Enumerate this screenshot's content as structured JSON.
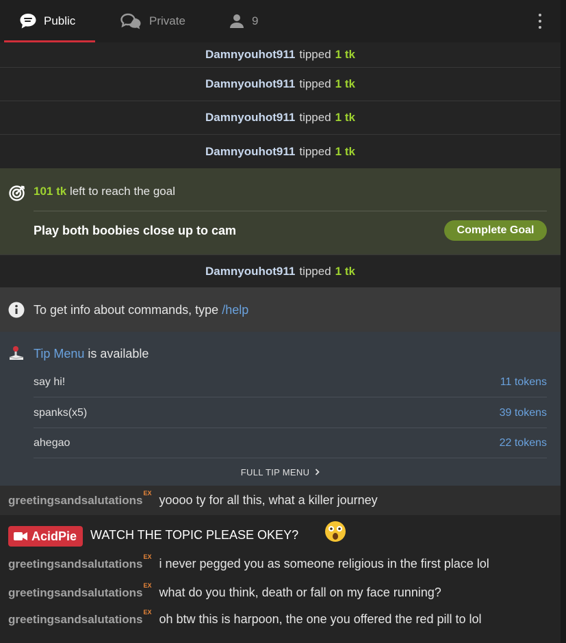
{
  "header": {
    "tabs": [
      {
        "label": "Public",
        "icon": "chat-bubble-icon",
        "active": true
      },
      {
        "label": "Private",
        "icon": "private-chat-icon",
        "active": false
      },
      {
        "label": "9",
        "icon": "user-icon",
        "active": false
      }
    ],
    "menu_icon": "kebab-menu-icon",
    "accent_color": "#d12f3a"
  },
  "tips_before_goal": [
    {
      "user": "Damnyouhot911",
      "verb": "tipped",
      "amount": "1 tk"
    },
    {
      "user": "Damnyouhot911",
      "verb": "tipped",
      "amount": "1 tk"
    },
    {
      "user": "Damnyouhot911",
      "verb": "tipped",
      "amount": "1 tk"
    },
    {
      "user": "Damnyouhot911",
      "verb": "tipped",
      "amount": "1 tk"
    }
  ],
  "goal": {
    "amount": "101 tk",
    "suffix": "left to reach the goal",
    "description": "Play both boobies close up to cam",
    "button": "Complete Goal",
    "icon": "target-icon"
  },
  "tips_after_goal": [
    {
      "user": "Damnyouhot911",
      "verb": "tipped",
      "amount": "1 tk"
    }
  ],
  "info": {
    "text": "To get info about commands, type",
    "command": "/help",
    "icon": "info-icon"
  },
  "tip_menu": {
    "link": "Tip Menu",
    "suffix": "is available",
    "icon": "joystick-icon",
    "items": [
      {
        "name": "say hi!",
        "price": "11 tokens"
      },
      {
        "name": "spanks(x5)",
        "price": "39 tokens"
      },
      {
        "name": "ahegao",
        "price": "22 tokens"
      }
    ],
    "full_menu": "FULL TIP MENU"
  },
  "messages": [
    {
      "user": "greetingsandsalutations",
      "badge": "EX",
      "text": "yoooo ty for all this, what a killer journey"
    },
    {
      "user": "greetingsandsalutations",
      "badge": "EX",
      "text": "i never pegged you as someone religious in the first place lol"
    },
    {
      "user": "greetingsandsalutations",
      "badge": "EX",
      "text": "what do you think, death or fall on my face running?"
    },
    {
      "user": "greetingsandsalutations",
      "badge": "EX",
      "text": "oh btw this is harpoon, the one you offered the red pill to lol"
    }
  ],
  "broadcaster_message": {
    "user": "AcidPie",
    "text": "WATCH THE TOPIC PLEASE OKEY?",
    "emoji": "shocked-face-emoji",
    "badge_color": "#d0323c"
  }
}
